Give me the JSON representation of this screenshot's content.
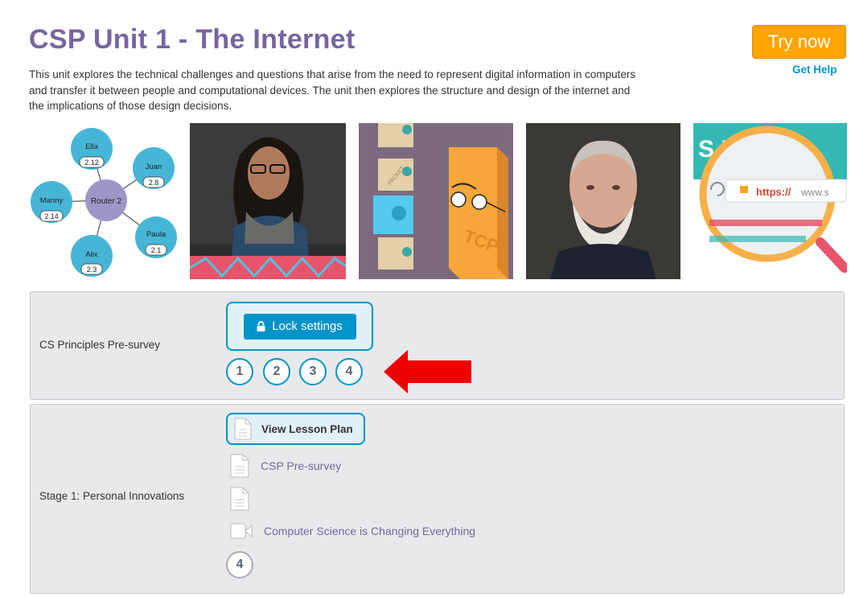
{
  "header": {
    "title": "CSP Unit 1 - The Internet",
    "description": "This unit explores the technical challenges and questions that arise from the need to represent digital information in computers and transfer it between people and computational devices. The unit then explores the structure and design of the internet and the implications of those design decisions.",
    "try_now": "Try now",
    "get_help": "Get Help"
  },
  "network": {
    "center": "Router 2",
    "nodes": [
      {
        "name": "Ella",
        "addr": "2.12"
      },
      {
        "name": "Juan",
        "addr": "2.8"
      },
      {
        "name": "Paula",
        "addr": "2.1"
      },
      {
        "name": "Alix",
        "addr": "2.3"
      },
      {
        "name": "Manny",
        "addr": "2.14"
      }
    ]
  },
  "thumb_text": {
    "packet": "PACKET",
    "tcp": "TCP",
    "https": "https://",
    "www": "www.s",
    "banner": "S     PR"
  },
  "stages": [
    {
      "label": "CS Principles Pre-survey",
      "lock_label": "Lock settings",
      "bubbles": [
        "1",
        "2",
        "3",
        "4"
      ]
    },
    {
      "label": "Stage 1: Personal Innovations",
      "lesson_plan": "View Lesson Plan",
      "items": [
        {
          "type": "doc",
          "text": "CSP Pre-survey"
        },
        {
          "type": "doc",
          "text": ""
        },
        {
          "type": "video",
          "text": "Computer Science is Changing Everything"
        }
      ],
      "bubble": "4"
    }
  ],
  "colors": {
    "title": "#7665a0",
    "accent": "#0094ca",
    "try_now": "#ffa400",
    "annotation_arrow": "#ee0000"
  }
}
